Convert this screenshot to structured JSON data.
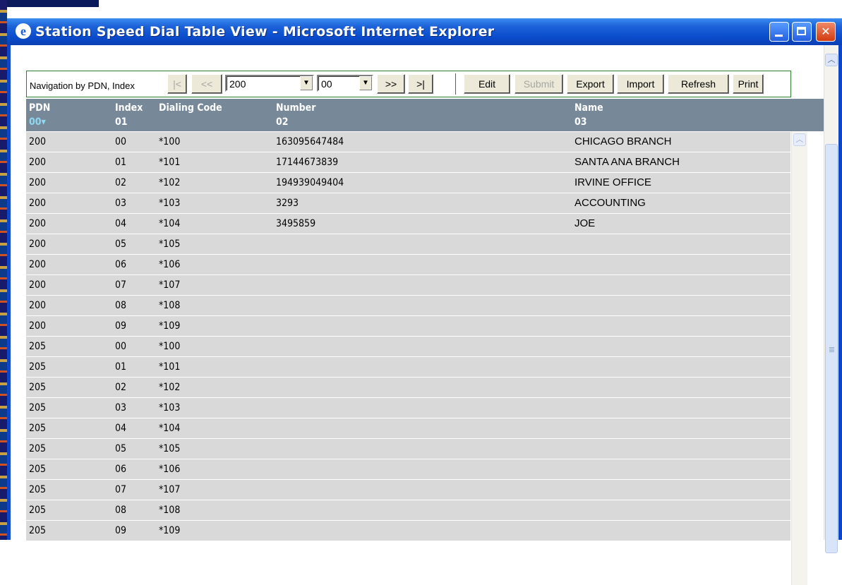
{
  "window": {
    "title": "Station Speed Dial Table View - Microsoft Internet Explorer",
    "minimize_label": "_",
    "maximize_label": "",
    "close_label": "✕",
    "ie_icon": "e"
  },
  "toolbar": {
    "nav_label": "Navigation by PDN, Index",
    "first_label": "|<",
    "prev_label": "<<",
    "pdn_value": "200",
    "index_value": "00",
    "next_label": ">>",
    "last_label": ">|",
    "edit_label": "Edit",
    "submit_label": "Submit",
    "export_label": "Export",
    "import_label": "Import",
    "refresh_label": "Refresh",
    "print_label": "Print"
  },
  "table": {
    "columns": [
      {
        "label": "PDN",
        "sub": "00▾"
      },
      {
        "label": "Index",
        "sub": "01"
      },
      {
        "label": "Dialing Code",
        "sub": ""
      },
      {
        "label": "Number",
        "sub": "02"
      },
      {
        "label": "Name",
        "sub": "03"
      }
    ],
    "rows": [
      {
        "pdn": "200",
        "index": "00",
        "code": "*100",
        "number": "163095647484",
        "name": "CHICAGO BRANCH"
      },
      {
        "pdn": "200",
        "index": "01",
        "code": "*101",
        "number": "17144673839",
        "name": "SANTA ANA BRANCH"
      },
      {
        "pdn": "200",
        "index": "02",
        "code": "*102",
        "number": "194939049404",
        "name": "IRVINE OFFICE"
      },
      {
        "pdn": "200",
        "index": "03",
        "code": "*103",
        "number": "3293",
        "name": "ACCOUNTING"
      },
      {
        "pdn": "200",
        "index": "04",
        "code": "*104",
        "number": "3495859",
        "name": "JOE"
      },
      {
        "pdn": "200",
        "index": "05",
        "code": "*105",
        "number": "",
        "name": ""
      },
      {
        "pdn": "200",
        "index": "06",
        "code": "*106",
        "number": "",
        "name": ""
      },
      {
        "pdn": "200",
        "index": "07",
        "code": "*107",
        "number": "",
        "name": ""
      },
      {
        "pdn": "200",
        "index": "08",
        "code": "*108",
        "number": "",
        "name": ""
      },
      {
        "pdn": "200",
        "index": "09",
        "code": "*109",
        "number": "",
        "name": ""
      },
      {
        "pdn": "205",
        "index": "00",
        "code": "*100",
        "number": "",
        "name": ""
      },
      {
        "pdn": "205",
        "index": "01",
        "code": "*101",
        "number": "",
        "name": ""
      },
      {
        "pdn": "205",
        "index": "02",
        "code": "*102",
        "number": "",
        "name": ""
      },
      {
        "pdn": "205",
        "index": "03",
        "code": "*103",
        "number": "",
        "name": ""
      },
      {
        "pdn": "205",
        "index": "04",
        "code": "*104",
        "number": "",
        "name": ""
      },
      {
        "pdn": "205",
        "index": "05",
        "code": "*105",
        "number": "",
        "name": ""
      },
      {
        "pdn": "205",
        "index": "06",
        "code": "*106",
        "number": "",
        "name": ""
      },
      {
        "pdn": "205",
        "index": "07",
        "code": "*107",
        "number": "",
        "name": ""
      },
      {
        "pdn": "205",
        "index": "08",
        "code": "*108",
        "number": "",
        "name": ""
      },
      {
        "pdn": "205",
        "index": "09",
        "code": "*109",
        "number": "",
        "name": ""
      }
    ]
  }
}
